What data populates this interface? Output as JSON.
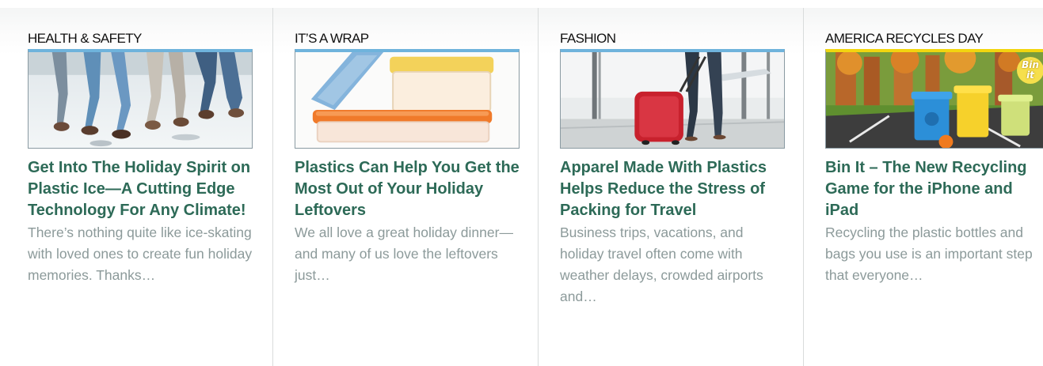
{
  "cards": [
    {
      "category": "HEALTH & SAFETY",
      "image_icon": "ice-skating-photo",
      "title": "Get Into The Holiday Spirit on Plastic Ice—A Cutting Edge Technology For Any Climate!",
      "excerpt": "There’s nothing quite like ice-skating with loved ones to create fun holiday memories. Thanks…"
    },
    {
      "category": "IT’S A WRAP",
      "image_icon": "food-containers-photo",
      "title": "Plastics Can Help You Get the Most Out of Your Holiday Leftovers",
      "excerpt": "We all love a great holiday dinner—and many of us love the leftovers just…"
    },
    {
      "category": "FASHION",
      "image_icon": "airport-luggage-photo",
      "title": "Apparel Made With Plastics Helps Reduce the Stress of Packing for Travel",
      "excerpt": "Business trips, vacations, and holiday travel often come with weather delays, crowded airports and…"
    },
    {
      "category": "AMERICA RECYCLES DAY",
      "image_icon": "recycling-game-illustration",
      "image_badge_text": "Bin it",
      "title": "Bin It – The New Recycling Game for the iPhone and iPad",
      "excerpt": "Recycling the plastic bottles and bags you use is an important step that everyone…"
    }
  ],
  "colors": {
    "title": "#2d6a57",
    "excerpt": "#8c9a9a",
    "category": "#111111",
    "accent_bar_blue": "#6fb3dc",
    "accent_bar_yellow": "#f2d50f",
    "divider": "#d9dcdc"
  }
}
